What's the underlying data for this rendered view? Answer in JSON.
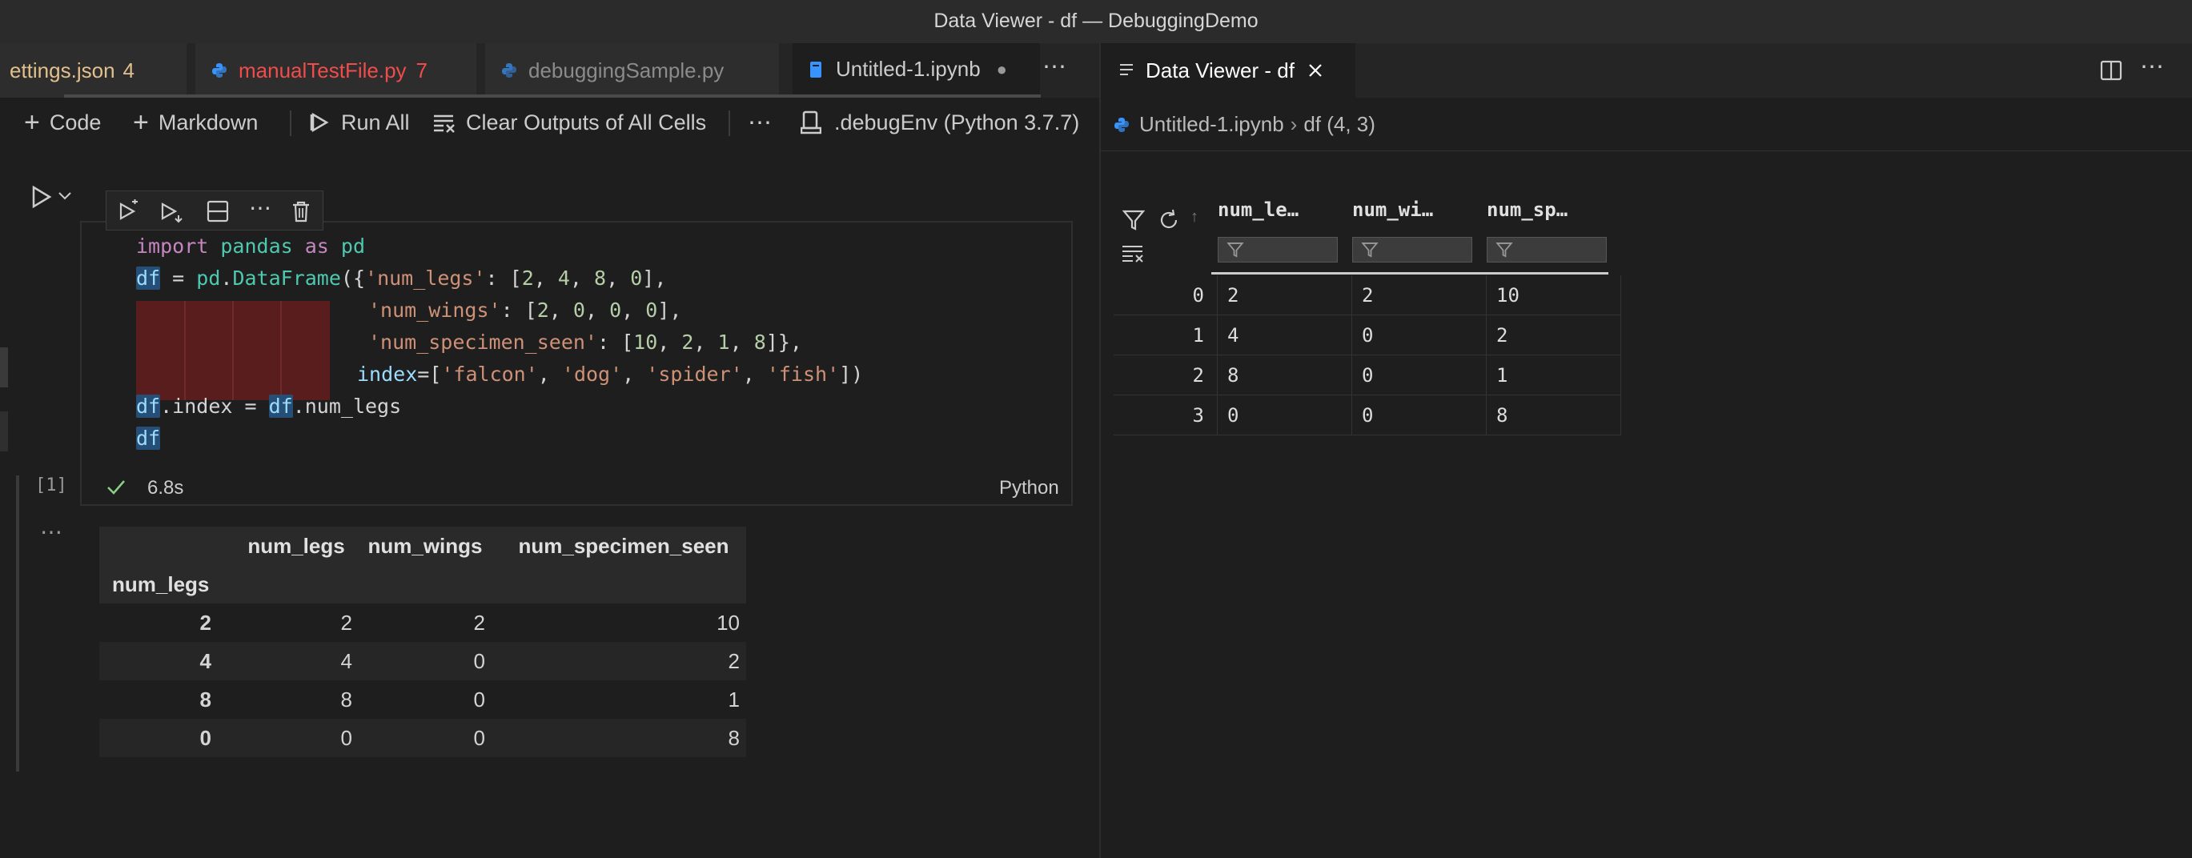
{
  "window": {
    "title": "Data Viewer - df — DebuggingDemo"
  },
  "left_tabs": [
    {
      "label": "ettings.json",
      "badge": "4",
      "color": "#e2c08d"
    },
    {
      "label": "manualTestFile.py",
      "badge": "7",
      "color": "#f14c4c"
    },
    {
      "label": "debuggingSample.py",
      "color": "#8b8b8b"
    },
    {
      "label": "Untitled-1.ipynb",
      "color": "#cccccc",
      "dirty": "●"
    }
  ],
  "toolbar": {
    "code": "Code",
    "markdown": "Markdown",
    "run_all": "Run All",
    "clear_outputs": "Clear Outputs of All Cells",
    "kernel": ".debugEnv (Python 3.7.7)"
  },
  "cell": {
    "exec_count": "[1]",
    "duration": "6.8s",
    "language": "Python",
    "code": {
      "l1_kw1": "import",
      "l1_mod": "pandas",
      "l1_kw2": "as",
      "l1_alias": "pd",
      "l2": [
        "df",
        " = ",
        "pd",
        ".",
        "DataFrame",
        "({",
        "'num_legs'",
        ": [",
        "2",
        ", ",
        "4",
        ", ",
        "8",
        ", ",
        "0",
        "],"
      ],
      "l3": [
        "'num_wings'",
        ": [",
        "2",
        ", ",
        "0",
        ", ",
        "0",
        ", ",
        "0",
        "],"
      ],
      "l4": [
        "'num_specimen_seen'",
        ": [",
        "10",
        ", ",
        "2",
        ", ",
        "1",
        ", ",
        "8",
        "]},"
      ],
      "l5": [
        "index",
        "=[",
        "'falcon'",
        ", ",
        "'dog'",
        ", ",
        "'spider'",
        ", ",
        "'fish'",
        "])"
      ],
      "l6": [
        "df",
        ".index = ",
        "df",
        ".num_legs"
      ],
      "l7": "df"
    }
  },
  "output_table": {
    "columns": [
      "num_legs",
      "num_wings",
      "num_specimen_seen"
    ],
    "index_name": "num_legs",
    "rows": [
      {
        "index": "2",
        "values": [
          "2",
          "2",
          "10"
        ]
      },
      {
        "index": "4",
        "values": [
          "4",
          "0",
          "2"
        ]
      },
      {
        "index": "8",
        "values": [
          "8",
          "0",
          "1"
        ]
      },
      {
        "index": "0",
        "values": [
          "0",
          "0",
          "8"
        ]
      }
    ]
  },
  "data_viewer": {
    "tab_label": "Data Viewer - df",
    "breadcrumb_file": "Untitled-1.ipynb",
    "breadcrumb_var": "df (4, 3)",
    "columns": [
      "num_le…",
      "num_wi…",
      "num_sp…"
    ],
    "rows": [
      {
        "index": "0",
        "values": [
          "2",
          "2",
          "10"
        ]
      },
      {
        "index": "1",
        "values": [
          "4",
          "0",
          "2"
        ]
      },
      {
        "index": "2",
        "values": [
          "8",
          "0",
          "1"
        ]
      },
      {
        "index": "3",
        "values": [
          "0",
          "0",
          "8"
        ]
      }
    ]
  },
  "colors": {
    "accent_python": "#3794ff",
    "warning": "#e2c08d",
    "error": "#f14c4c",
    "success": "#89d185"
  }
}
